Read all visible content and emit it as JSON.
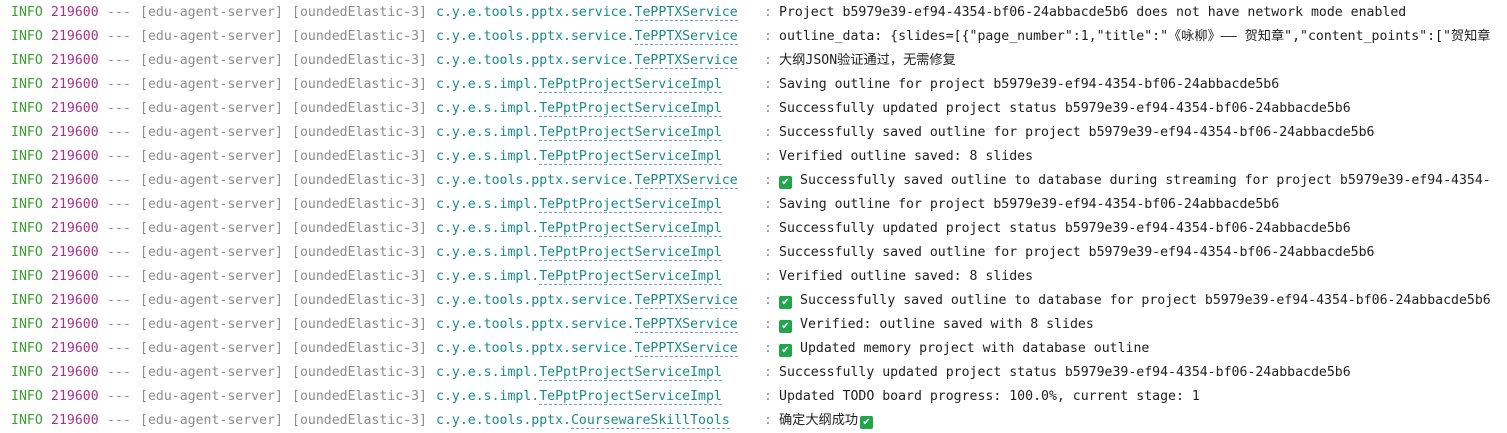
{
  "log": {
    "lines": [
      {
        "level": "INFO",
        "pid": "219600",
        "sep": "---",
        "app": "[edu-agent-server]",
        "thread": "[oundedElastic-3]",
        "logger_pkg": "c.y.e.tools.pptx.service.",
        "logger_cls": "TePPTXService",
        "colon": ":",
        "icon": "",
        "message": "Project b5979e39-ef94-4354-bf06-24abbacde5b6 does not have network mode enabled",
        "icon_after": ""
      },
      {
        "level": "INFO",
        "pid": "219600",
        "sep": "---",
        "app": "[edu-agent-server]",
        "thread": "[oundedElastic-3]",
        "logger_pkg": "c.y.e.tools.pptx.service.",
        "logger_cls": "TePPTXService",
        "colon": ":",
        "icon": "",
        "message": "outline_data: {slides=[{\"page_number\":1,\"title\":\"《咏柳》—— 贺知章\",\"content_points\":[\"贺知章",
        "icon_after": ""
      },
      {
        "level": "INFO",
        "pid": "219600",
        "sep": "---",
        "app": "[edu-agent-server]",
        "thread": "[oundedElastic-3]",
        "logger_pkg": "c.y.e.tools.pptx.service.",
        "logger_cls": "TePPTXService",
        "colon": ":",
        "icon": "",
        "message": "大纲JSON验证通过，无需修复",
        "icon_after": ""
      },
      {
        "level": "INFO",
        "pid": "219600",
        "sep": "---",
        "app": "[edu-agent-server]",
        "thread": "[oundedElastic-3]",
        "logger_pkg": "c.y.e.s.impl.",
        "logger_cls": "TePptProjectServiceImpl",
        "colon": ":",
        "icon": "",
        "message": "Saving outline for project b5979e39-ef94-4354-bf06-24abbacde5b6",
        "icon_after": ""
      },
      {
        "level": "INFO",
        "pid": "219600",
        "sep": "---",
        "app": "[edu-agent-server]",
        "thread": "[oundedElastic-3]",
        "logger_pkg": "c.y.e.s.impl.",
        "logger_cls": "TePptProjectServiceImpl",
        "colon": ":",
        "icon": "",
        "message": "Successfully updated project status b5979e39-ef94-4354-bf06-24abbacde5b6",
        "icon_after": ""
      },
      {
        "level": "INFO",
        "pid": "219600",
        "sep": "---",
        "app": "[edu-agent-server]",
        "thread": "[oundedElastic-3]",
        "logger_pkg": "c.y.e.s.impl.",
        "logger_cls": "TePptProjectServiceImpl",
        "colon": ":",
        "icon": "",
        "message": "Successfully saved outline for project b5979e39-ef94-4354-bf06-24abbacde5b6",
        "icon_after": ""
      },
      {
        "level": "INFO",
        "pid": "219600",
        "sep": "---",
        "app": "[edu-agent-server]",
        "thread": "[oundedElastic-3]",
        "logger_pkg": "c.y.e.s.impl.",
        "logger_cls": "TePptProjectServiceImpl",
        "colon": ":",
        "icon": "",
        "message": "Verified outline saved: 8 slides",
        "icon_after": ""
      },
      {
        "level": "INFO",
        "pid": "219600",
        "sep": "---",
        "app": "[edu-agent-server]",
        "thread": "[oundedElastic-3]",
        "logger_pkg": "c.y.e.tools.pptx.service.",
        "logger_cls": "TePPTXService",
        "colon": ":",
        "icon": "✔",
        "message": "Successfully saved outline to database during streaming for project b5979e39-ef94-4354-",
        "icon_after": ""
      },
      {
        "level": "INFO",
        "pid": "219600",
        "sep": "---",
        "app": "[edu-agent-server]",
        "thread": "[oundedElastic-3]",
        "logger_pkg": "c.y.e.s.impl.",
        "logger_cls": "TePptProjectServiceImpl",
        "colon": ":",
        "icon": "",
        "message": "Saving outline for project b5979e39-ef94-4354-bf06-24abbacde5b6",
        "icon_after": ""
      },
      {
        "level": "INFO",
        "pid": "219600",
        "sep": "---",
        "app": "[edu-agent-server]",
        "thread": "[oundedElastic-3]",
        "logger_pkg": "c.y.e.s.impl.",
        "logger_cls": "TePptProjectServiceImpl",
        "colon": ":",
        "icon": "",
        "message": "Successfully updated project status b5979e39-ef94-4354-bf06-24abbacde5b6",
        "icon_after": ""
      },
      {
        "level": "INFO",
        "pid": "219600",
        "sep": "---",
        "app": "[edu-agent-server]",
        "thread": "[oundedElastic-3]",
        "logger_pkg": "c.y.e.s.impl.",
        "logger_cls": "TePptProjectServiceImpl",
        "colon": ":",
        "icon": "",
        "message": "Successfully saved outline for project b5979e39-ef94-4354-bf06-24abbacde5b6",
        "icon_after": ""
      },
      {
        "level": "INFO",
        "pid": "219600",
        "sep": "---",
        "app": "[edu-agent-server]",
        "thread": "[oundedElastic-3]",
        "logger_pkg": "c.y.e.s.impl.",
        "logger_cls": "TePptProjectServiceImpl",
        "colon": ":",
        "icon": "",
        "message": "Verified outline saved: 8 slides",
        "icon_after": ""
      },
      {
        "level": "INFO",
        "pid": "219600",
        "sep": "---",
        "app": "[edu-agent-server]",
        "thread": "[oundedElastic-3]",
        "logger_pkg": "c.y.e.tools.pptx.service.",
        "logger_cls": "TePPTXService",
        "colon": ":",
        "icon": "✔",
        "message": "Successfully saved outline to database for project b5979e39-ef94-4354-bf06-24abbacde5b6",
        "icon_after": ""
      },
      {
        "level": "INFO",
        "pid": "219600",
        "sep": "---",
        "app": "[edu-agent-server]",
        "thread": "[oundedElastic-3]",
        "logger_pkg": "c.y.e.tools.pptx.service.",
        "logger_cls": "TePPTXService",
        "colon": ":",
        "icon": "✔",
        "message": "Verified: outline saved with 8 slides",
        "icon_after": ""
      },
      {
        "level": "INFO",
        "pid": "219600",
        "sep": "---",
        "app": "[edu-agent-server]",
        "thread": "[oundedElastic-3]",
        "logger_pkg": "c.y.e.tools.pptx.service.",
        "logger_cls": "TePPTXService",
        "colon": ":",
        "icon": "✔",
        "message": "Updated memory project with database outline",
        "icon_after": ""
      },
      {
        "level": "INFO",
        "pid": "219600",
        "sep": "---",
        "app": "[edu-agent-server]",
        "thread": "[oundedElastic-3]",
        "logger_pkg": "c.y.e.s.impl.",
        "logger_cls": "TePptProjectServiceImpl",
        "colon": ":",
        "icon": "",
        "message": "Successfully updated project status b5979e39-ef94-4354-bf06-24abbacde5b6",
        "icon_after": ""
      },
      {
        "level": "INFO",
        "pid": "219600",
        "sep": "---",
        "app": "[edu-agent-server]",
        "thread": "[oundedElastic-3]",
        "logger_pkg": "c.y.e.s.impl.",
        "logger_cls": "TePptProjectServiceImpl",
        "colon": ":",
        "icon": "",
        "message": "Updated TODO board progress: 100.0%, current stage: 1",
        "icon_after": ""
      },
      {
        "level": "INFO",
        "pid": "219600",
        "sep": "---",
        "app": "[edu-agent-server]",
        "thread": "[oundedElastic-3]",
        "logger_pkg": "c.y.e.tools.pptx.",
        "logger_cls": "CoursewareSkillTools",
        "colon": ":",
        "icon": "",
        "message": "确定大纲成功",
        "icon_after": "✔"
      }
    ]
  },
  "colors": {
    "level": "#3f9c35",
    "pid": "#a8338f",
    "muted": "#8c8c8c",
    "logger": "#1b8a8a",
    "check": "#1fa64a",
    "text": "#1f1f1f"
  }
}
